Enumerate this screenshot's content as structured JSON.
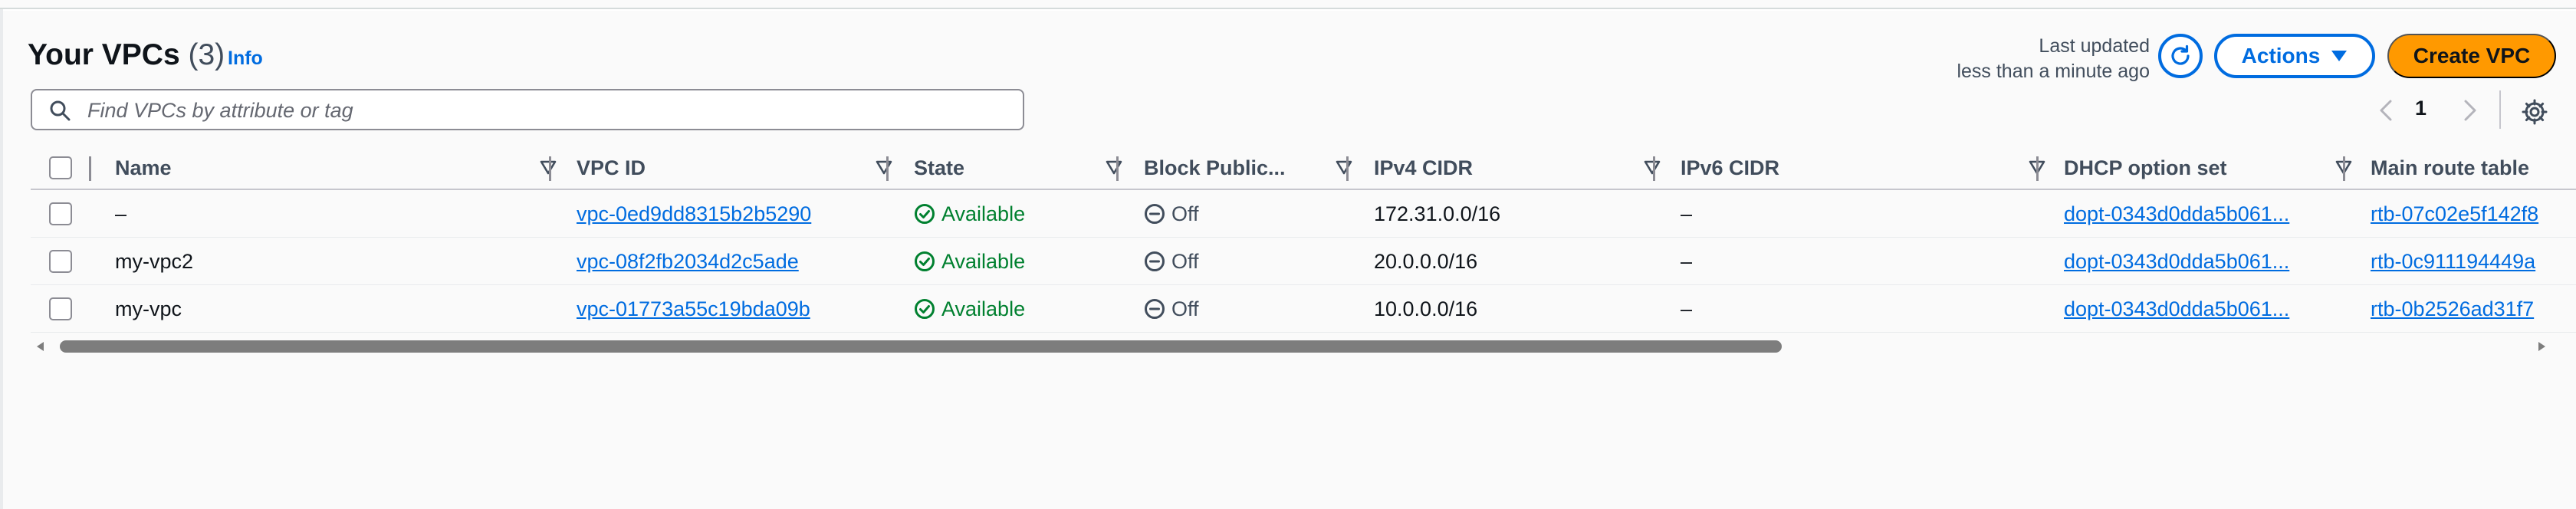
{
  "header": {
    "title": "Your VPCs",
    "count": "(3)",
    "info_label": "Info",
    "last_updated_line1": "Last updated",
    "last_updated_line2": "less than a minute ago",
    "actions_label": "Actions",
    "create_label": "Create VPC"
  },
  "search": {
    "placeholder": "Find VPCs by attribute or tag",
    "value": ""
  },
  "pagination": {
    "current_page": "1"
  },
  "table": {
    "columns": [
      "Name",
      "VPC ID",
      "State",
      "Block Public...",
      "IPv4 CIDR",
      "IPv6 CIDR",
      "DHCP option set",
      "Main route table"
    ],
    "rows": [
      {
        "name": "–",
        "vpc_id": "vpc-0ed9dd8315b2b5290",
        "state": "Available",
        "block_public": "Off",
        "ipv4": "172.31.0.0/16",
        "ipv6": "–",
        "dhcp": "dopt-0343d0dda5b061...",
        "route_table": "rtb-07c02e5f142f8"
      },
      {
        "name": "my-vpc2",
        "vpc_id": "vpc-08f2fb2034d2c5ade",
        "state": "Available",
        "block_public": "Off",
        "ipv4": "20.0.0.0/16",
        "ipv6": "–",
        "dhcp": "dopt-0343d0dda5b061...",
        "route_table": "rtb-0c911194449a"
      },
      {
        "name": "my-vpc",
        "vpc_id": "vpc-01773a55c19bda09b",
        "state": "Available",
        "block_public": "Off",
        "ipv4": "10.0.0.0/16",
        "ipv6": "–",
        "dhcp": "dopt-0343d0dda5b061...",
        "route_table": "rtb-0b2526ad31f7"
      }
    ]
  },
  "colors": {
    "link": "#006ce0",
    "success": "#00802f",
    "primary_button": "#ff9900"
  },
  "icons": [
    "search-icon",
    "refresh-icon",
    "caret-down-icon",
    "chevron-left-icon",
    "chevron-right-icon",
    "settings-icon",
    "sort-icon",
    "status-positive-icon",
    "status-off-icon"
  ]
}
